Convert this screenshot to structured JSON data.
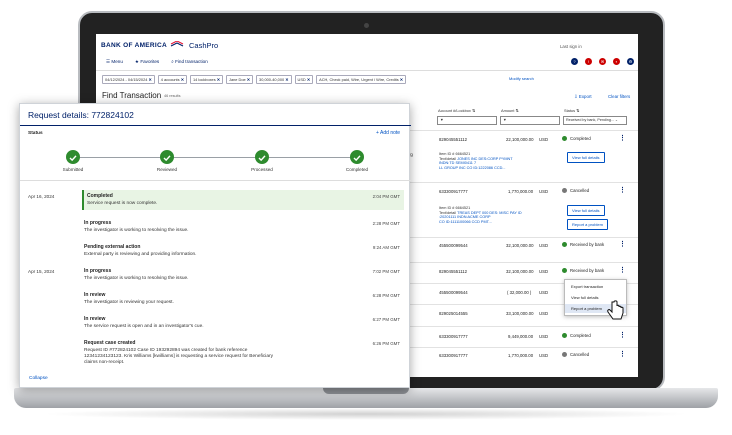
{
  "app": {
    "brand": "BANK OF AMERICA",
    "product": "CashPro",
    "login_text": "Last sign in"
  },
  "nav": [
    "Menu",
    "Favorites",
    "Find transaction"
  ],
  "filters": [
    "04/12/2024 - 04/15/2024",
    "4 accounts",
    "14 lockboxes",
    "Jane Doe",
    "30,000-40,000",
    "USD",
    "ACH, Check paid, Wire, Urgent / Wire, Credits"
  ],
  "modify_search": "Modify search",
  "find": {
    "title": "Find Transaction",
    "count": "46 results",
    "export": "Export",
    "clear": "Clear filters"
  },
  "columns": [
    "Account #/Lockbox",
    "Amount",
    "Status"
  ],
  "status_filter": "Received by bank, Pending...",
  "rows": [
    {
      "acct": "829045551112",
      "amt": "22,100,000.00",
      "cur": "USD",
      "status": "Completed",
      "color": "#2e8b2e"
    },
    {
      "acct": "633300917777",
      "amt": "1,770,000.00",
      "cur": "USD",
      "status": "Cancelled",
      "color": "#777"
    },
    {
      "acct": "455500099544",
      "amt": "32,100,000.00",
      "cur": "USD",
      "status": "Received by bank",
      "color": "#2e8b2e"
    },
    {
      "acct": "829045551112",
      "amt": "32,100,000.00",
      "cur": "USD",
      "status": "Received by bank",
      "color": "#2e8b2e"
    },
    {
      "acct": "455500099544",
      "amt": "( 32,000.00 )",
      "cur": "USD",
      "status": "",
      "color": ""
    },
    {
      "acct": "829025014555",
      "amt": "33,100,000.00",
      "cur": "USD",
      "status": "",
      "color": ""
    },
    {
      "acct": "633300917777",
      "amt": "9,449,000.00",
      "cur": "USD",
      "status": "Completed",
      "color": "#2e8b2e"
    },
    {
      "acct": "633300917777",
      "amt": "1,770,000.00",
      "cur": "USD",
      "status": "Cancelled",
      "color": "#777"
    }
  ],
  "detail1": {
    "lbl1": "Item ID #",
    "val1": "6664521",
    "lbl2": "Text/detail",
    "val2": "JONES INC DES:CORP PYMNT",
    "val3": "INDN:TD SEMI0411 7",
    "val4": "LL GROUP INC CO ID:1222086 CCD..."
  },
  "detail2": {
    "lbl1": "Item ID #",
    "val1": "6664521",
    "lbl2": "Text/detail",
    "val2": "TREAS DEPT 000 DES: MISC PAY ID",
    "val3": ":20201111 INDN:ACME CORP",
    "val4": "CO ID:1111100066 CCD PMT..."
  },
  "left_frag": [
    "rg"
  ],
  "buttons": {
    "view_full": "View full details",
    "report": "Report a problem"
  },
  "menu": [
    "Export transaction",
    "View full details",
    "Report a problem"
  ],
  "panel": {
    "title": "Request details: 772824102",
    "status_label": "Status",
    "add_note": "Add note",
    "collapse": "Collapse"
  },
  "steps": [
    "Submitted",
    "Reviewed",
    "Processed",
    "Completed"
  ],
  "dates": [
    "Apr 16, 2024",
    "Apr 15, 2024"
  ],
  "events": [
    {
      "title": "Completed",
      "desc": "Service request is now complete.",
      "time": "2:04 PM GMT"
    },
    {
      "title": "In progress",
      "desc": "The investigator is working to resolving the issue.",
      "time": "2:28 PM GMT"
    },
    {
      "title": "Pending external action",
      "desc": "External party is reviewing and providing information.",
      "time": "9:24 AM GMT"
    },
    {
      "title": "In progress",
      "desc": "The investigator is working to resolving the issue.",
      "time": "7:02 PM GMT"
    },
    {
      "title": "In review",
      "desc": "The investigator is reviewing your request.",
      "time": "6:28 PM GMT"
    },
    {
      "title": "In review",
      "desc": "The service request is open and in an investigator's cue.",
      "time": "6:27 PM GMT"
    },
    {
      "title": "Request case created",
      "desc1": "Request ID #772824102 Case ID 193292894 was created for bank reference",
      "desc2": "12341234123123. Kris Williams [kwilliams] is requesting a service request for Beneficiary",
      "desc3": "claims non-receipt.",
      "time": "6:26 PM GMT"
    }
  ]
}
